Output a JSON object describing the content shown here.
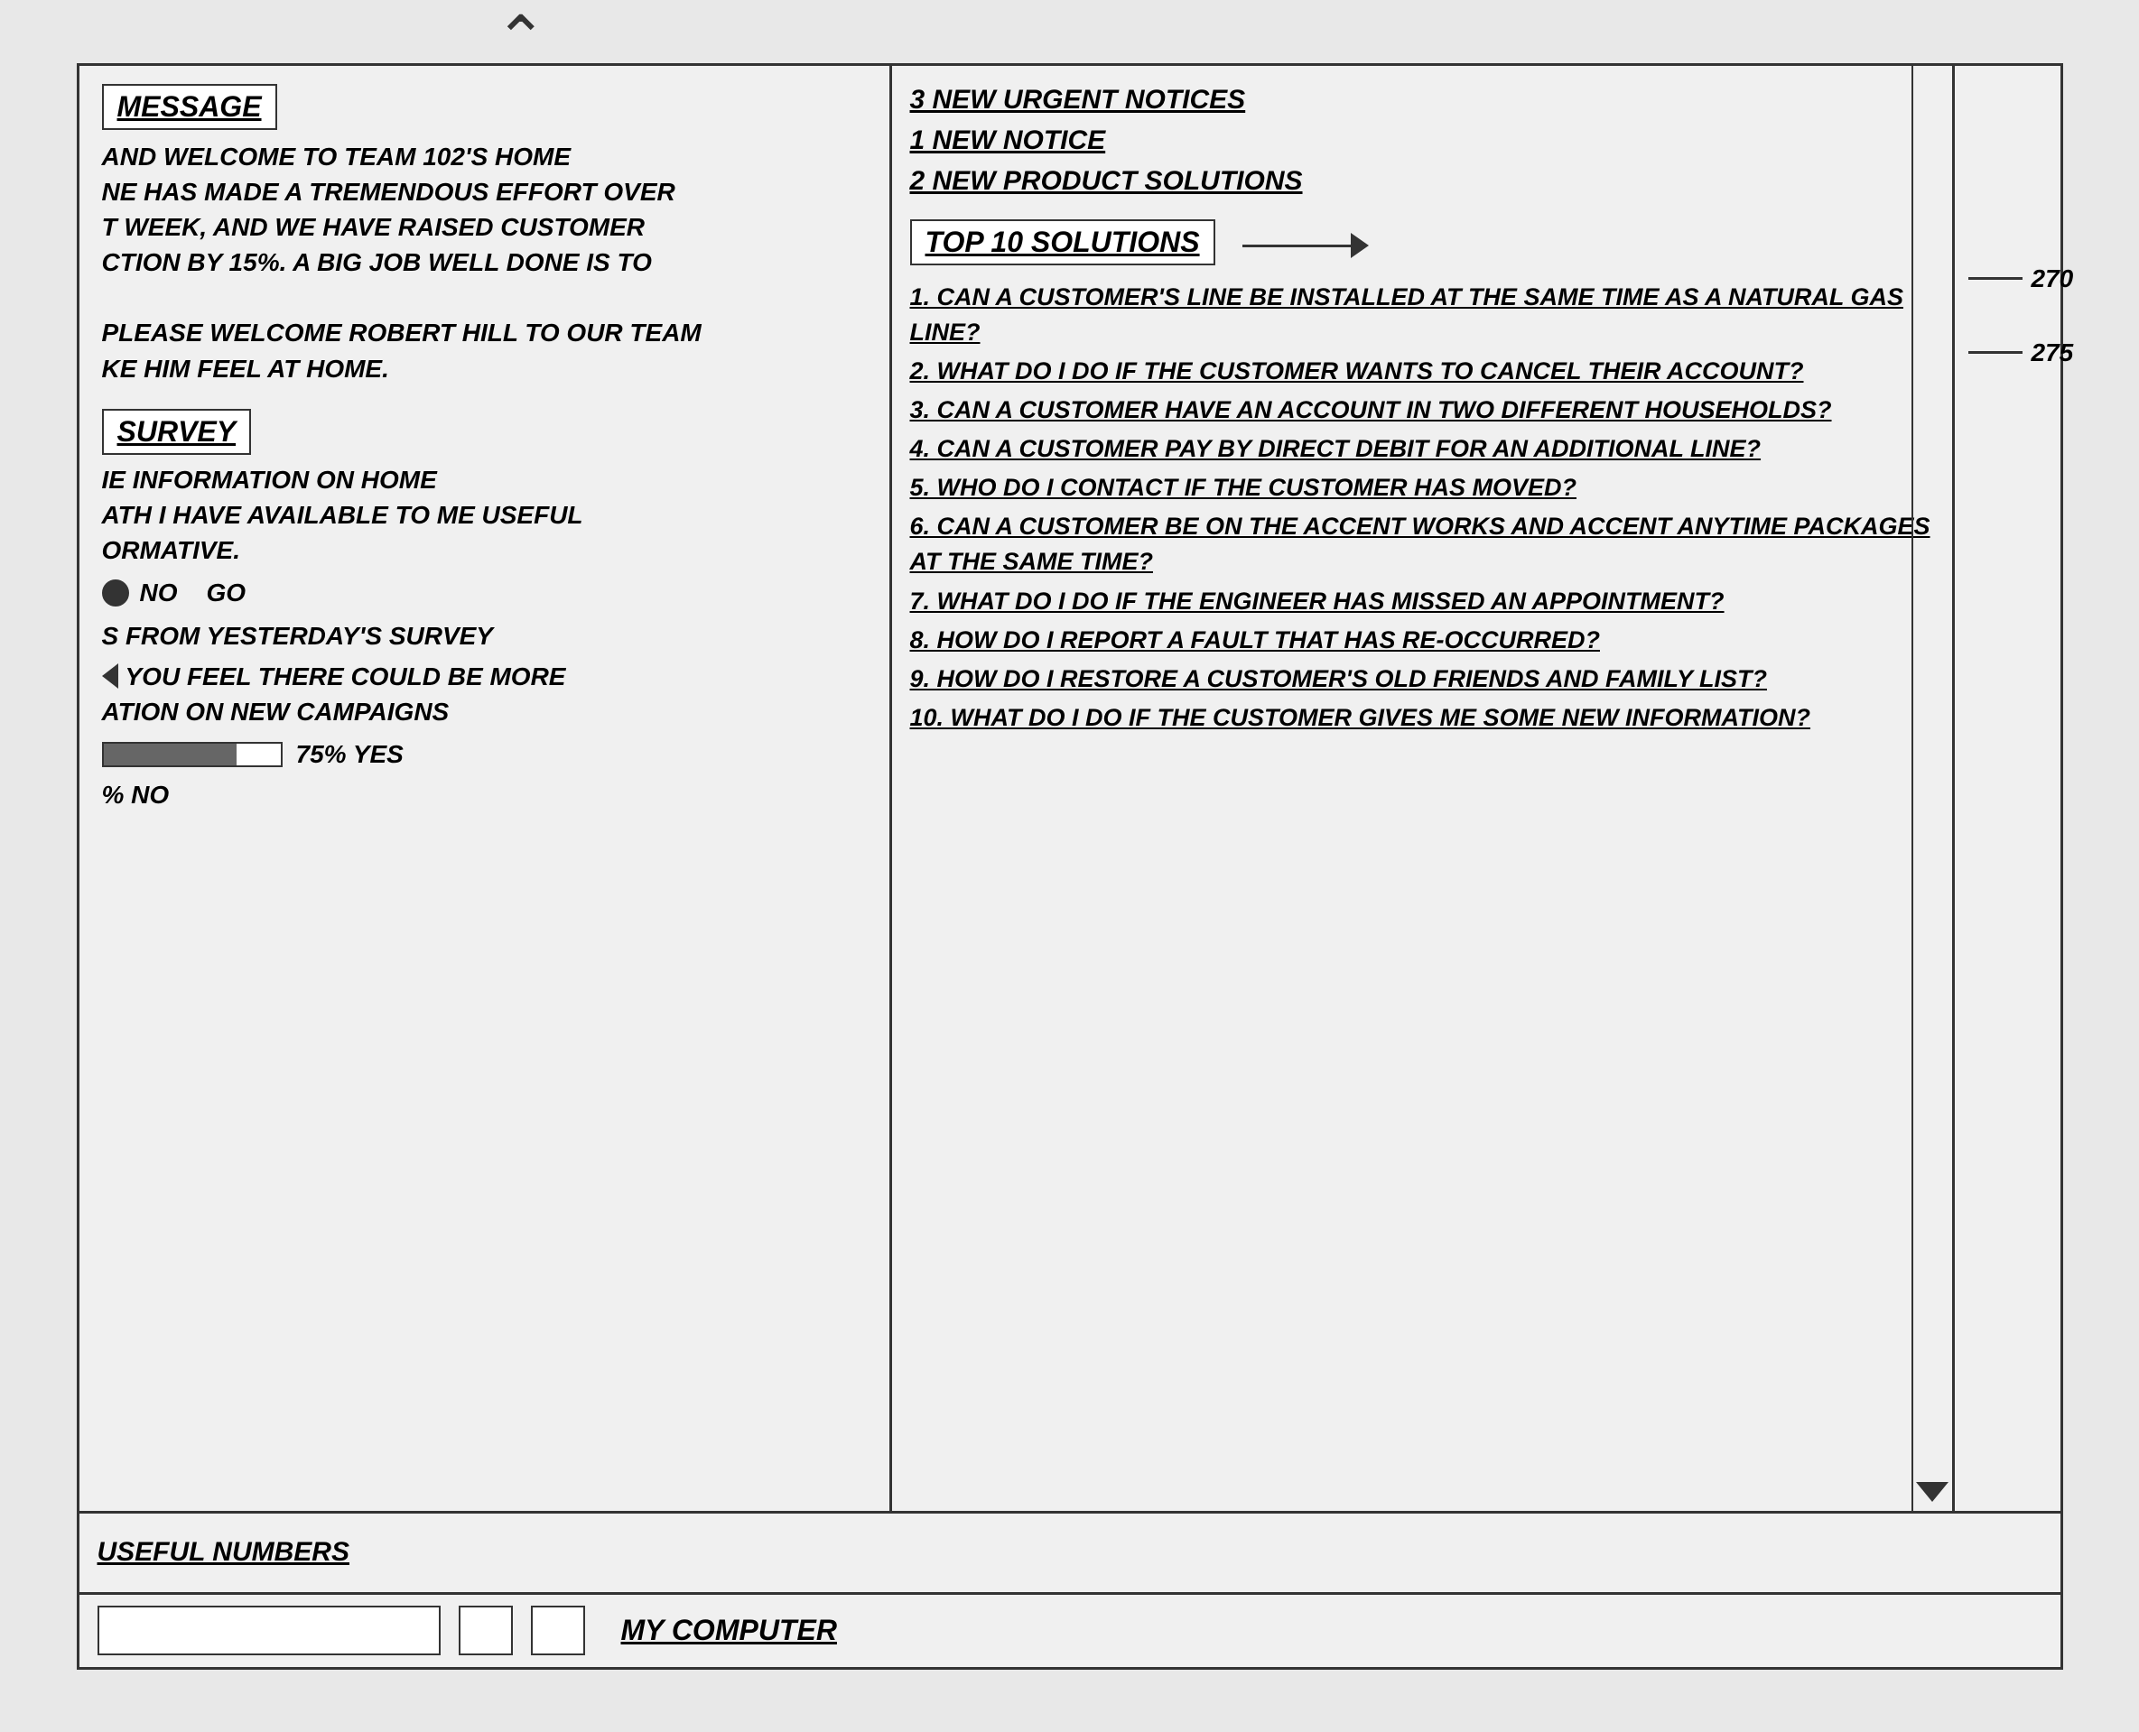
{
  "notices": {
    "urgent": "3 NEW URGENT NOTICES",
    "new_notice": "1 NEW NOTICE",
    "new_product": "2 NEW PRODUCT SOLUTIONS"
  },
  "top10": {
    "title": "TOP 10 SOLUTIONS",
    "items": [
      "1. CAN A CUSTOMER'S LINE BE INSTALLED AT THE SAME TIME AS A NATURAL GAS LINE?",
      "2. WHAT DO I DO IF THE CUSTOMER WANTS TO CANCEL THEIR ACCOUNT?",
      "3. CAN A CUSTOMER HAVE AN ACCOUNT IN TWO DIFFERENT HOUSEHOLDS?",
      "4. CAN A CUSTOMER PAY BY DIRECT DEBIT FOR AN ADDITIONAL LINE?",
      "5. WHO DO I CONTACT IF THE CUSTOMER HAS MOVED?",
      "6. CAN A CUSTOMER BE ON THE ACCENT WORKS AND ACCENT ANYTIME PACKAGES AT THE SAME TIME?",
      "7. WHAT DO I DO IF THE ENGINEER HAS MISSED AN APPOINTMENT?",
      "8. HOW DO I REPORT A FAULT THAT HAS RE-OCCURRED?",
      "9. HOW DO I RESTORE A CUSTOMER'S OLD FRIENDS AND FAMILY LIST?",
      "10. WHAT DO I DO IF THE CUSTOMER GIVES ME SOME NEW INFORMATION?"
    ]
  },
  "message": {
    "title": "MESSAGE",
    "body_line1": "AND WELCOME TO TEAM 102'S HOME",
    "body_line2": "NE HAS MADE A TREMENDOUS EFFORT OVER",
    "body_line3": "T WEEK, AND WE HAVE RAISED CUSTOMER",
    "body_line4": "CTION BY 15%. A BIG JOB WELL DONE IS TO",
    "body_line5": "",
    "body_line6": "PLEASE WELCOME ROBERT HILL TO OUR TEAM",
    "body_line7": "KE HIM FEEL AT HOME."
  },
  "survey": {
    "title": "SURVEY",
    "question": "IE INFORMATION ON HOME",
    "line2": "ATH I HAVE AVAILABLE TO ME USEFUL",
    "line3": "ORMATIVE.",
    "radio_no": "NO",
    "radio_go": "GO",
    "from_yesterday": "S FROM YESTERDAY'S SURVEY",
    "arrow_text": "YOU FEEL THERE COULD BE MORE",
    "more_line": "ATION ON NEW CAMPAIGNS",
    "yes_percent": "75% YES",
    "no_percent": "% NO"
  },
  "labels": {
    "label_270": "270",
    "label_275": "275"
  },
  "bottom": {
    "useful_numbers": "USEFUL NUMBERS",
    "my_computer": "MY COMPUTER"
  }
}
